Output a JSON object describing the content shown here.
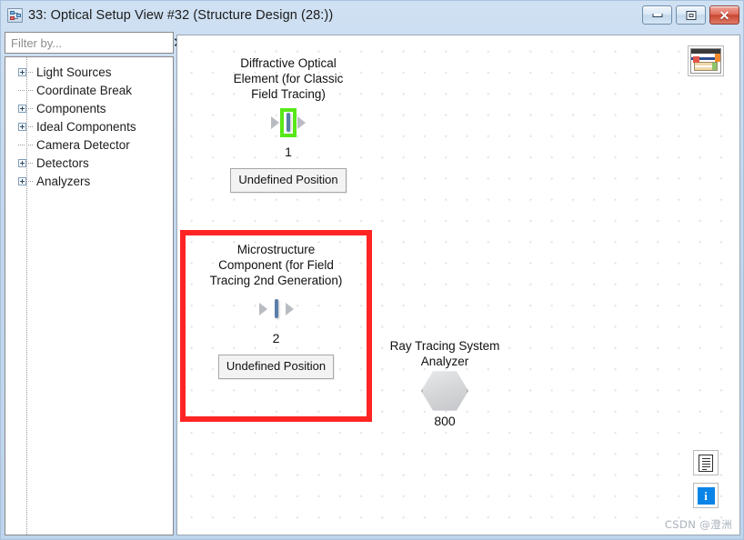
{
  "window": {
    "title": "33: Optical Setup View #32 (Structure Design (28:))",
    "icon": "optical-setup-icon",
    "buttons": {
      "minimize": "minimize-icon",
      "maximize": "restore-icon",
      "close": "✕"
    }
  },
  "sidebar": {
    "filter": {
      "value": "",
      "placeholder": "Filter by...",
      "clear_label": "✕"
    },
    "tree": [
      {
        "label": "Light Sources",
        "expandable": true
      },
      {
        "label": "Coordinate Break",
        "expandable": false
      },
      {
        "label": "Components",
        "expandable": true
      },
      {
        "label": "Ideal Components",
        "expandable": true
      },
      {
        "label": "Camera Detector",
        "expandable": false
      },
      {
        "label": "Detectors",
        "expandable": true
      },
      {
        "label": "Analyzers",
        "expandable": true
      }
    ]
  },
  "canvas": {
    "nodes": [
      {
        "title": "Diffractive Optical\nElement (for Classic\nField Tracing)",
        "number": "1",
        "position_label": "Undefined\nPosition",
        "selected": true,
        "shape": "rectangle"
      },
      {
        "title": "Microstructure\nComponent (for Field\nTracing 2nd Generation)",
        "number": "2",
        "position_label": "Undefined\nPosition",
        "selected": false,
        "shape": "rectangle"
      },
      {
        "title": "Ray Tracing System\nAnalyzer",
        "number": "800",
        "shape": "hexagon"
      }
    ],
    "annotation": {
      "type": "red-rectangle-highlight",
      "color": "#ff2424",
      "targets": "node-2"
    },
    "icons": {
      "table": "table-view-icon",
      "document": "document-icon",
      "info": "info-icon",
      "info_glyph": "i"
    },
    "watermark": "CSDN @澄洲"
  },
  "colors": {
    "selection": "#59e817",
    "annotation": "#ff2424",
    "title_bar": "#cfe0f2",
    "component_border": "#5b7ea8"
  }
}
